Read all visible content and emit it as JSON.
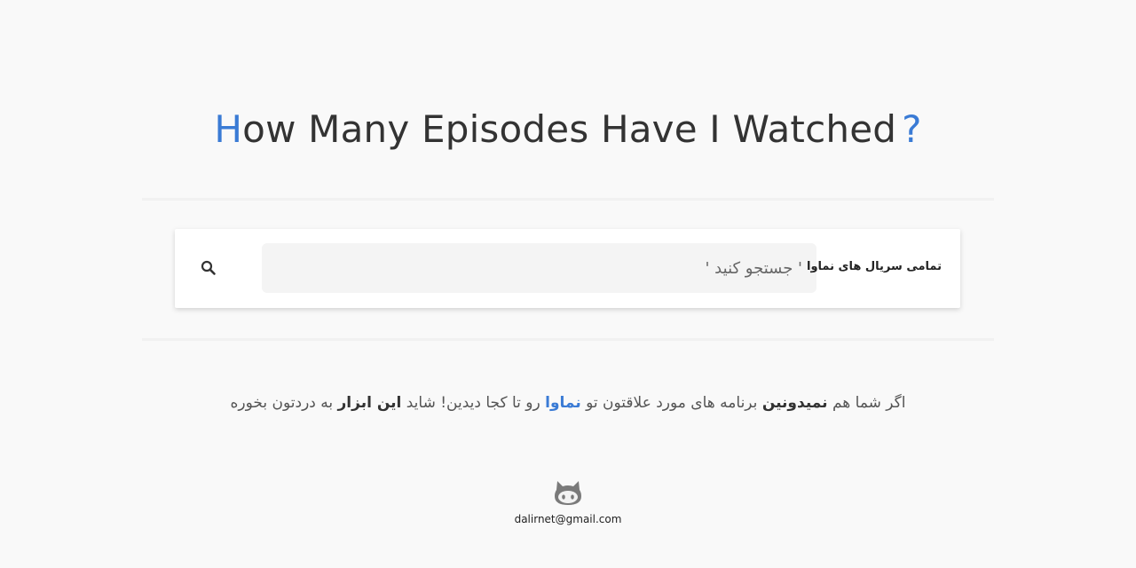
{
  "header": {
    "title_first_letter": "H",
    "title_rest": "ow Many Episodes Have I Watched",
    "title_mark": "?"
  },
  "search": {
    "placeholder": "' جستجو کنید '",
    "value": "",
    "scope_label": "تمامی سریال های نماوا",
    "icon": "search-icon"
  },
  "tagline": {
    "part1": "اگر شما هم ",
    "bold1": "نمیدونین",
    "part2": " برنامه های مورد علاقتون تو ",
    "brand": "نماوا",
    "part3": " رو تا کجا دیدین! شاید ",
    "bold2": "این ابزار",
    "part4": " به دردتون بخوره"
  },
  "footer": {
    "icon": "github-icon",
    "email": "dalirnet@gmail.com"
  },
  "colors": {
    "accent": "#3a7bd5",
    "background": "#f9f9f9",
    "text": "#333333"
  }
}
